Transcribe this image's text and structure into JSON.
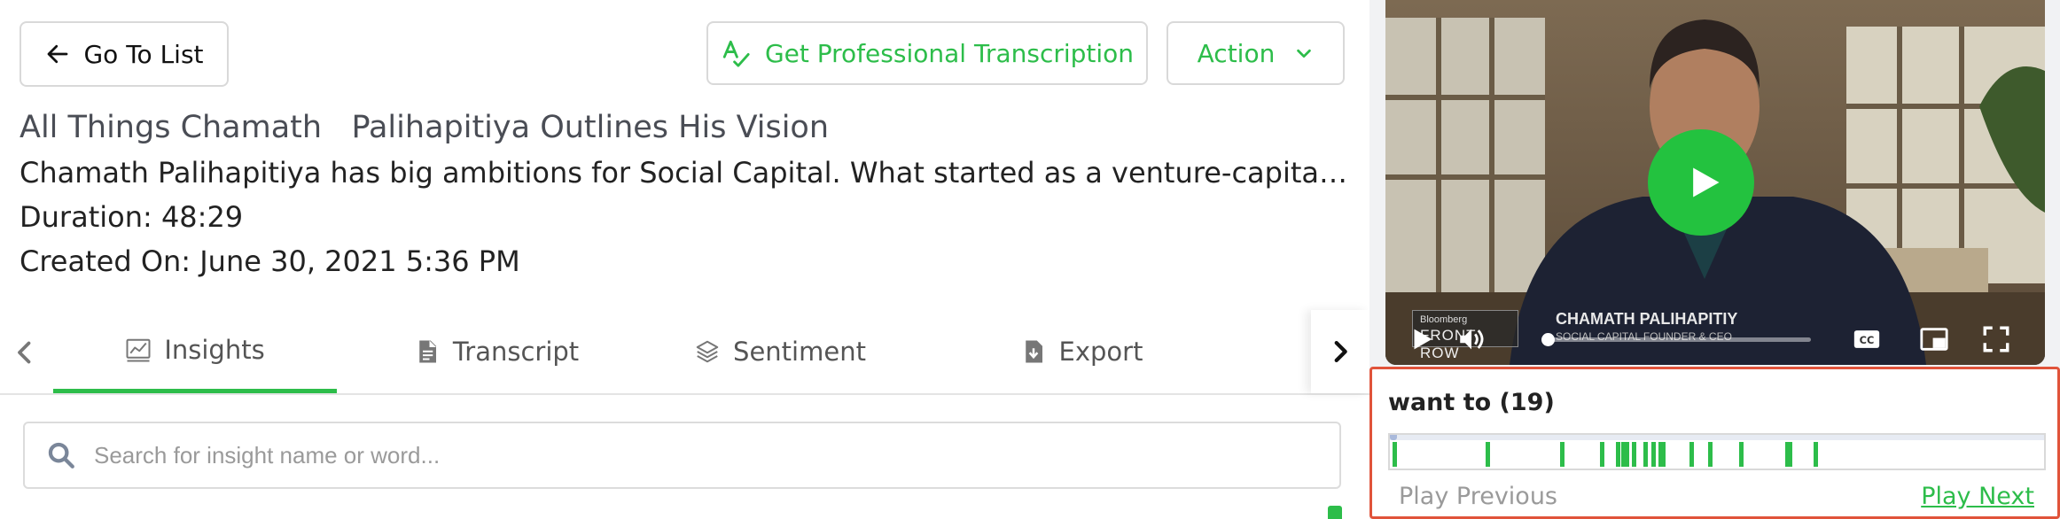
{
  "header": {
    "go_to_list_label": "Go To List",
    "get_pro_label": "Get Professional Transcription",
    "action_label": "Action"
  },
  "media": {
    "title": "All Things Chamath   Palihapitiya Outlines His Vision",
    "description": "Chamath Palihapitiya has big ambitions for Social Capital. What started as a venture-capital firm has evolved into something much bigger, and he shares his vision for the future.",
    "duration": "Duration: 48:29",
    "created_on": "Created On: June 30, 2021 5:36 PM"
  },
  "tabs": [
    {
      "label": "Insights",
      "icon": "chart-icon",
      "active": true
    },
    {
      "label": "Transcript",
      "icon": "document-icon",
      "active": false
    },
    {
      "label": "Sentiment",
      "icon": "layers-icon",
      "active": false
    },
    {
      "label": "Export",
      "icon": "download-icon",
      "active": false
    }
  ],
  "search": {
    "placeholder": "Search for insight name or word..."
  },
  "video": {
    "lower_third_small": "Bloomberg",
    "lower_third_big": "FRONT ROW",
    "speaker_name": "CHAMATH PALIHAPITIY",
    "speaker_title": "SOCIAL CAPITAL FOUNDER & CEO",
    "progress_fraction": 0.0
  },
  "occurrences": {
    "title": "want to (19)",
    "positions": [
      0.004,
      0.148,
      0.262,
      0.324,
      0.348,
      0.356,
      0.362,
      0.373,
      0.39,
      0.402,
      0.413,
      0.418,
      0.461,
      0.49,
      0.537,
      0.608,
      0.612,
      0.652,
      0.613
    ],
    "play_previous_label": "Play Previous",
    "play_next_label": "Play Next"
  },
  "colors": {
    "accent": "#2dbd4a",
    "highlight_border": "#e0533a"
  }
}
